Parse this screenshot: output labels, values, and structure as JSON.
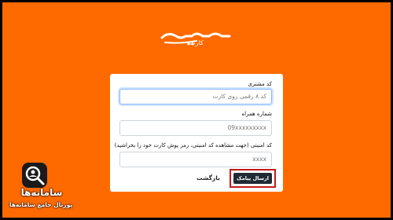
{
  "brand": {
    "logo_sub": "کارت",
    "bg_color": "#ff6a00"
  },
  "form": {
    "card_code_label": "کد مشتری",
    "card_code_placeholder": "کد ۸ رقمی روی کارت",
    "phone_label": "شماره همراه",
    "phone_placeholder": "09xxxxxxxxx",
    "security_label": "کد امنیتی (جهت مشاهده کد امنیتی، رمز پوش کارت خود را بخراشید)",
    "security_placeholder": "xxxx",
    "send_label": "ارسال پیامک",
    "back_label": "بازگشت"
  },
  "watermark": {
    "title": "سامانه‌ها",
    "subtitle": "پورتال جامع سامانه‌ها"
  }
}
